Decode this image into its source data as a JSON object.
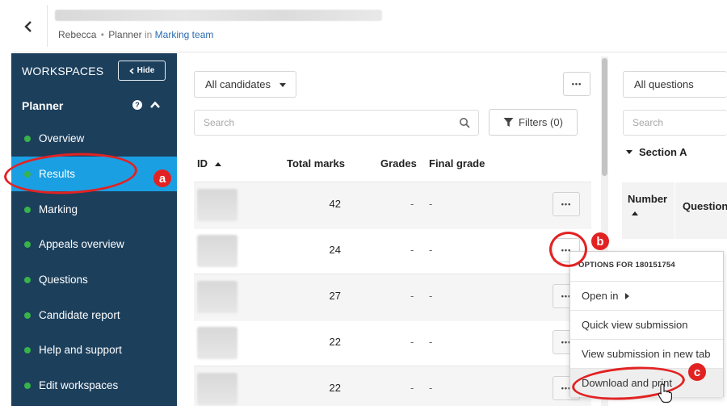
{
  "header": {
    "breadcrumb_user": "Rebecca",
    "breadcrumb_sep": "•",
    "breadcrumb_role": "Planner",
    "breadcrumb_in": "in",
    "breadcrumb_team": "Marking team"
  },
  "sidebar": {
    "workspaces_label": "WORKSPACES",
    "hide_label": "Hide",
    "planner_label": "Planner",
    "items": [
      {
        "label": "Overview"
      },
      {
        "label": "Results"
      },
      {
        "label": "Marking"
      },
      {
        "label": "Appeals overview"
      },
      {
        "label": "Questions"
      },
      {
        "label": "Candidate report"
      },
      {
        "label": "Help and support"
      },
      {
        "label": "Edit workspaces"
      }
    ],
    "active_index": 1
  },
  "candidates": {
    "filter_selected": "All candidates",
    "search_placeholder": "Search",
    "filters_label": "Filters (0)",
    "columns": {
      "id": "ID",
      "total_marks": "Total marks",
      "grades": "Grades",
      "final_grade": "Final grade"
    },
    "rows": [
      {
        "total_marks": "42",
        "grades": "-",
        "final_grade": "-"
      },
      {
        "total_marks": "24",
        "grades": "-",
        "final_grade": "-"
      },
      {
        "total_marks": "27",
        "grades": "-",
        "final_grade": "-"
      },
      {
        "total_marks": "22",
        "grades": "-",
        "final_grade": "-"
      },
      {
        "total_marks": "22",
        "grades": "-",
        "final_grade": "-"
      }
    ],
    "more_label": "•••"
  },
  "questions": {
    "filter_selected": "All questions",
    "search_placeholder": "Search",
    "section_label": "Section A",
    "col_number": "Number",
    "col_question": "Question"
  },
  "context_menu": {
    "title": "OPTIONS FOR 180151754",
    "items": [
      {
        "label": "Open in"
      },
      {
        "label": "Quick view submission"
      },
      {
        "label": "View submission in new tab"
      },
      {
        "label": "Download and print"
      }
    ]
  },
  "annotations": {
    "a": "a",
    "b": "b",
    "c": "c"
  },
  "colors": {
    "sidebar_bg": "#1c3f5c",
    "active_item": "#1a9fe3",
    "status_dot": "#37b34a",
    "annotation": "#e22222",
    "link": "#2b6cb0"
  }
}
